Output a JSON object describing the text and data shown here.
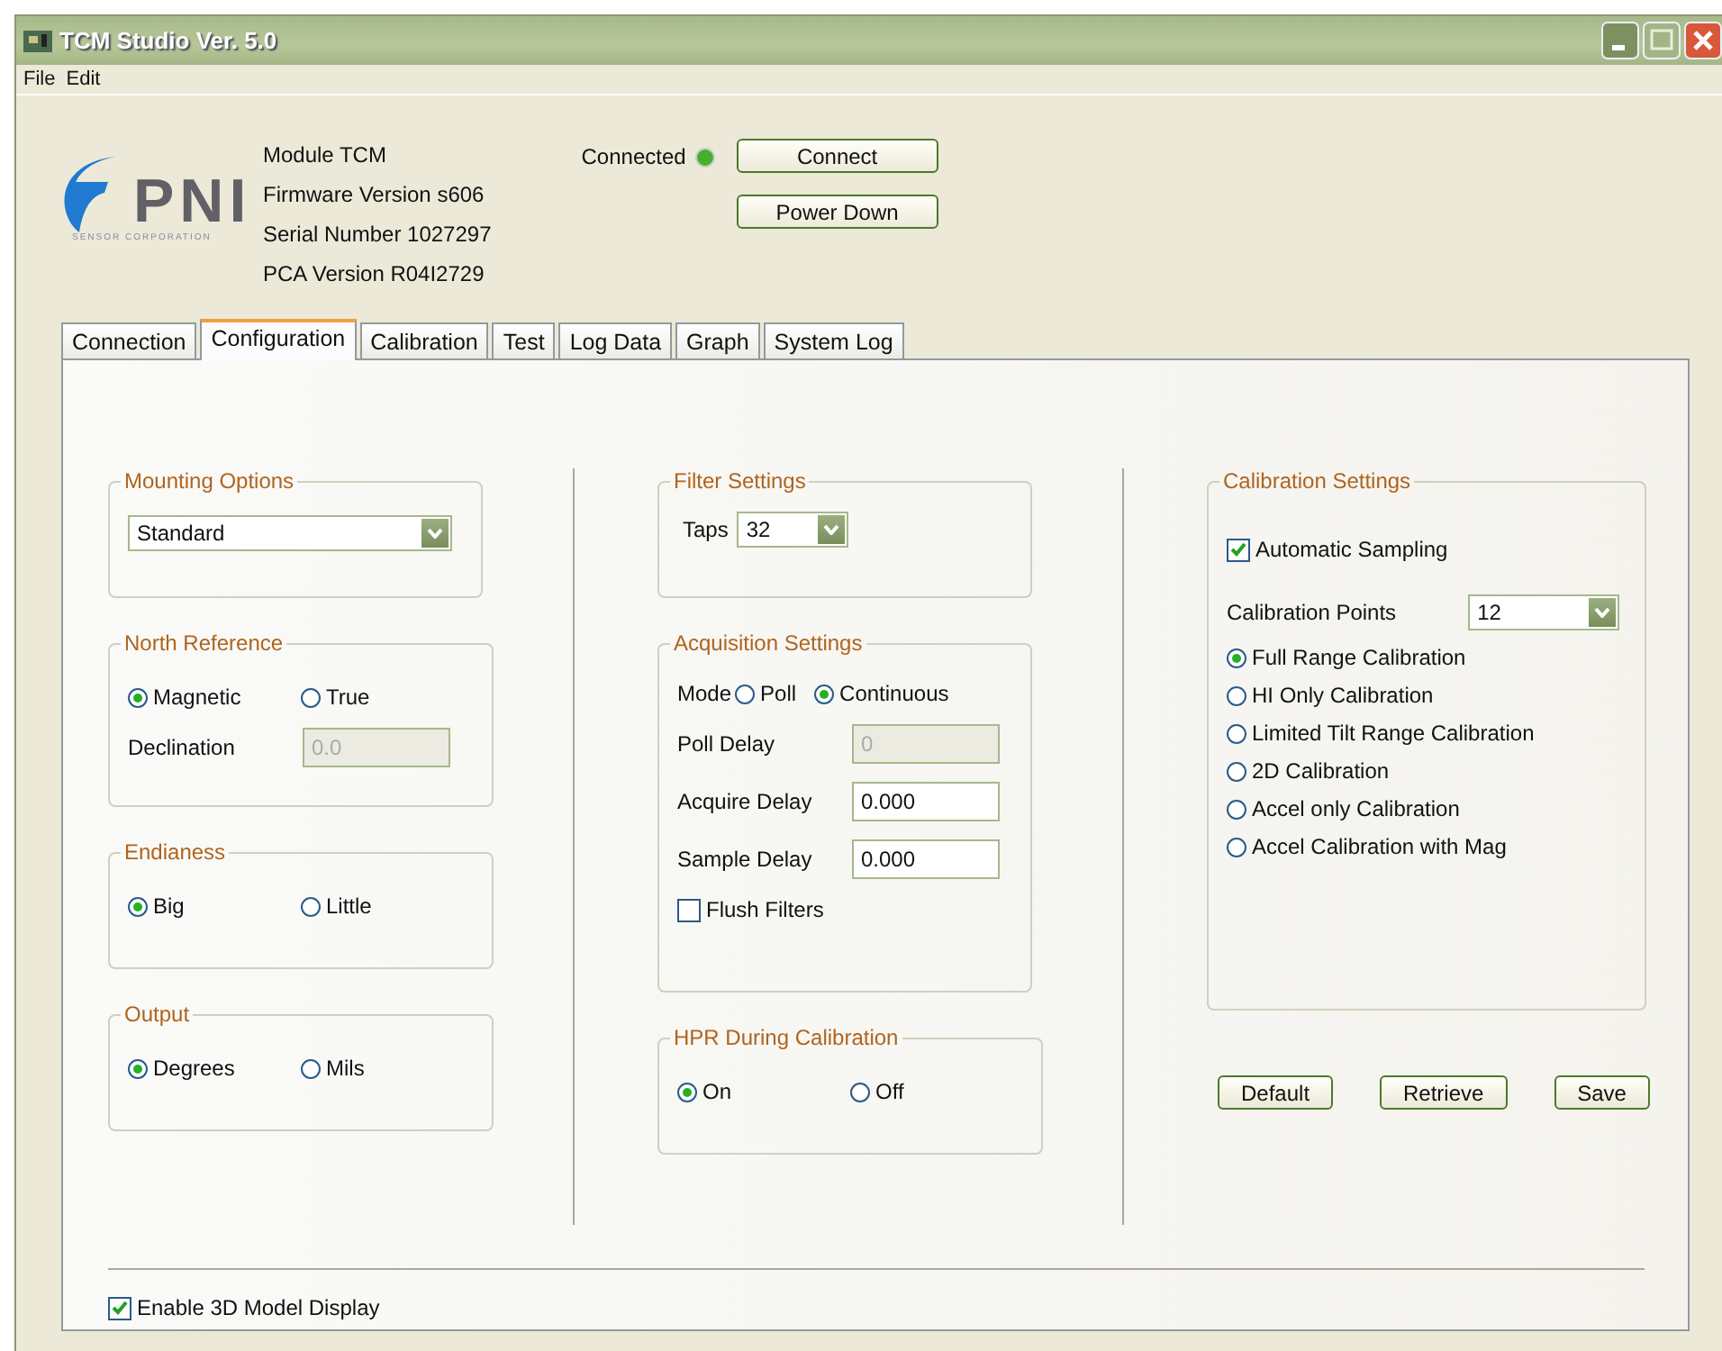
{
  "window": {
    "title": "TCM Studio Ver. 5.0"
  },
  "menu": [
    "File",
    "Edit"
  ],
  "logo": {
    "text": "PNI",
    "subtext": "SENSOR CORPORATION"
  },
  "module_info": [
    "Module TCM",
    "Firmware Version s606",
    "Serial Number 1027297",
    "PCA Version R04I2729"
  ],
  "connection": {
    "status": "Connected",
    "connected": true
  },
  "header_buttons": [
    "Connect",
    "Power Down"
  ],
  "tabs": [
    {
      "label": "Connection",
      "selected": false
    },
    {
      "label": "Configuration",
      "selected": true
    },
    {
      "label": "Calibration",
      "selected": false
    },
    {
      "label": "Test",
      "selected": false
    },
    {
      "label": "Log Data",
      "selected": false
    },
    {
      "label": "Graph",
      "selected": false
    },
    {
      "label": "System Log",
      "selected": false
    }
  ],
  "mounting_options": {
    "title": "Mounting Options",
    "value": "Standard"
  },
  "north_reference": {
    "title": "North Reference",
    "options": [
      {
        "label": "Magnetic",
        "selected": true
      },
      {
        "label": "True",
        "selected": false
      }
    ],
    "declination": {
      "label": "Declination",
      "value": "0.0",
      "disabled": true
    }
  },
  "endianess": {
    "title": "Endianess",
    "options": [
      {
        "label": "Big",
        "selected": true
      },
      {
        "label": "Little",
        "selected": false
      }
    ]
  },
  "output": {
    "title": "Output",
    "options": [
      {
        "label": "Degrees",
        "selected": true
      },
      {
        "label": "Mils",
        "selected": false
      }
    ]
  },
  "filter_settings": {
    "title": "Filter Settings",
    "label": "Taps",
    "value": "32"
  },
  "acquisition_settings": {
    "title": "Acquisition Settings",
    "mode_label": "Mode",
    "modes": [
      {
        "label": "Poll",
        "selected": false
      },
      {
        "label": "Continuous",
        "selected": true
      }
    ],
    "fields": [
      {
        "label": "Poll Delay",
        "value": "0",
        "disabled": true
      },
      {
        "label": "Acquire Delay",
        "value": "0.000",
        "disabled": false
      },
      {
        "label": "Sample Delay",
        "value": "0.000",
        "disabled": false
      }
    ],
    "flush_filters": {
      "label": "Flush Filters",
      "checked": false
    }
  },
  "hpr_during_calibration": {
    "title": "HPR During Calibration",
    "options": [
      {
        "label": "On",
        "selected": true
      },
      {
        "label": "Off",
        "selected": false
      }
    ]
  },
  "calibration_settings": {
    "title": "Calibration Settings",
    "automatic_sampling": {
      "label": "Automatic Sampling",
      "checked": true
    },
    "points_label": "Calibration Points",
    "points_value": "12",
    "methods": [
      {
        "label": "Full Range Calibration",
        "selected": true
      },
      {
        "label": "HI Only Calibration",
        "selected": false
      },
      {
        "label": "Limited Tilt Range Calibration",
        "selected": false
      },
      {
        "label": "2D Calibration",
        "selected": false
      },
      {
        "label": "Accel only Calibration",
        "selected": false
      },
      {
        "label": "Accel Calibration with Mag",
        "selected": false
      }
    ]
  },
  "action_buttons": [
    "Default",
    "Retrieve",
    "Save"
  ],
  "enable_3d": {
    "label": "Enable 3D Model Display",
    "checked": true
  }
}
